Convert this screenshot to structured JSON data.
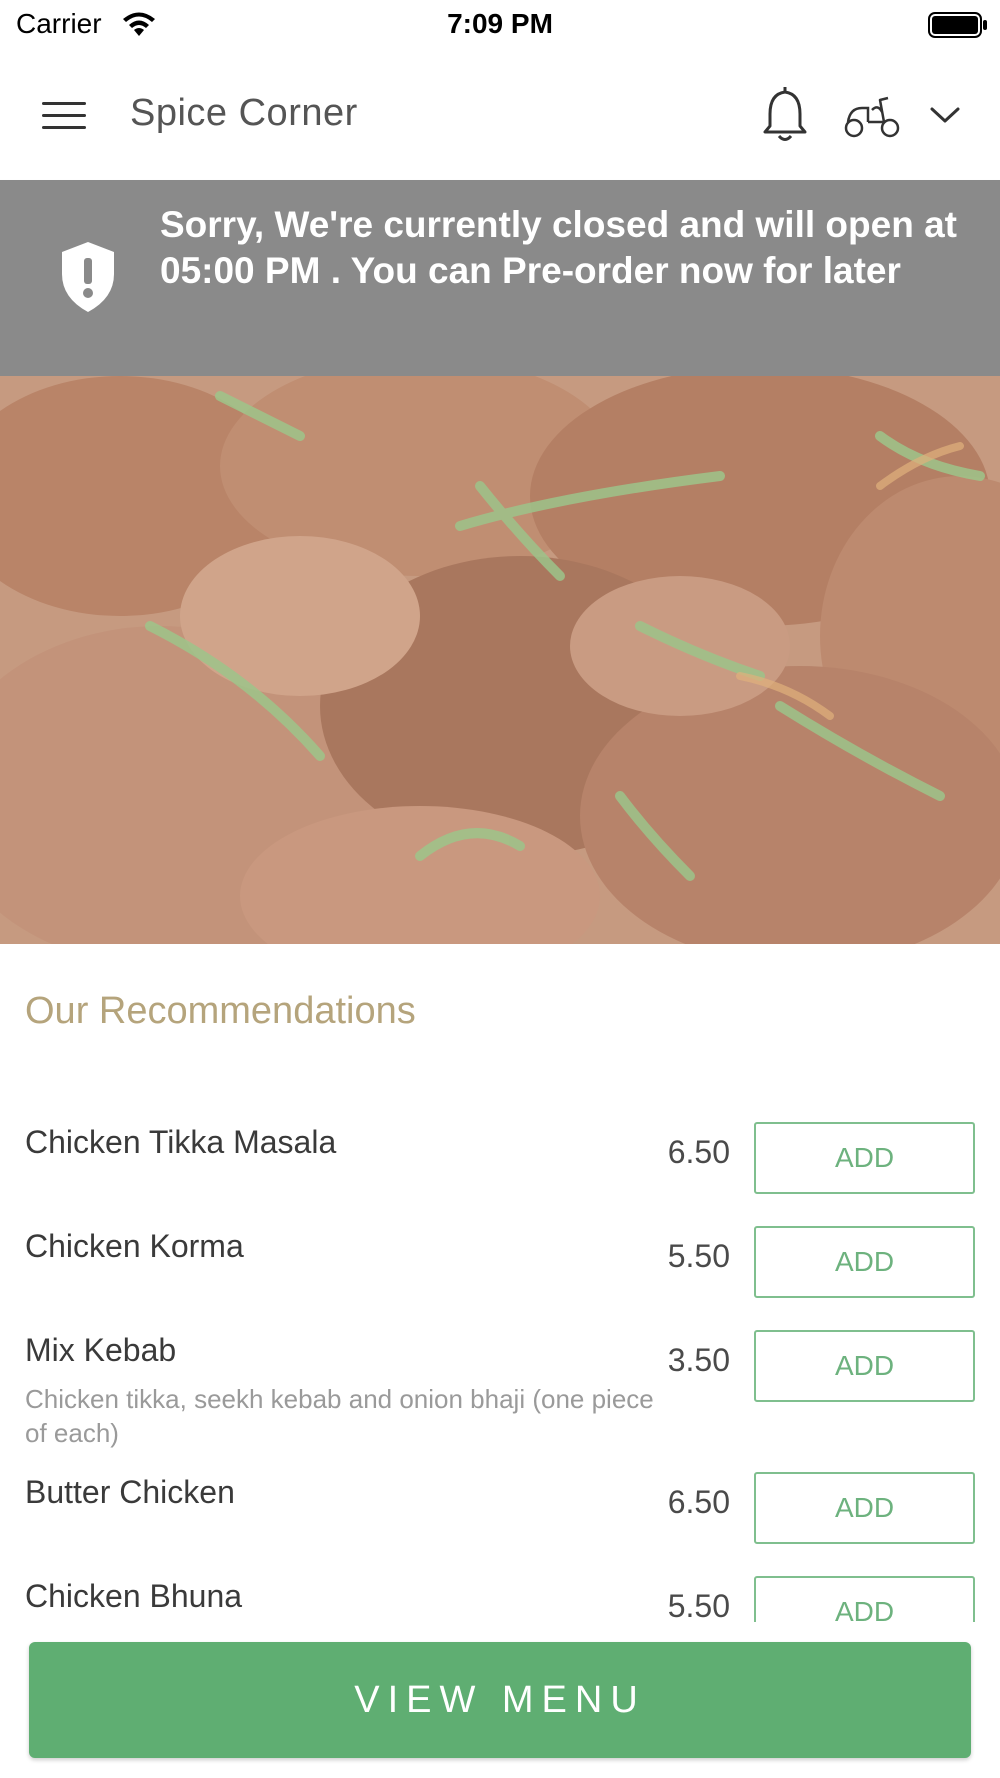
{
  "status_bar": {
    "carrier": "Carrier",
    "time": "7:09 PM"
  },
  "header": {
    "title": "Spice Corner",
    "icons": [
      "menu-icon",
      "bell-icon",
      "scooter-icon",
      "chevron-down-icon"
    ]
  },
  "banner": {
    "message": "Sorry, We're currently closed and will open at 05:00 PM . You can Pre-order now for later",
    "icon": "shield-alert-icon",
    "background": "#8a8a8a"
  },
  "recommendations": {
    "title": "Our Recommendations",
    "items": [
      {
        "name": "Chicken Tikka Masala",
        "description": "",
        "price": "6.50",
        "button": "ADD"
      },
      {
        "name": "Chicken Korma",
        "description": "",
        "price": "5.50",
        "button": "ADD"
      },
      {
        "name": "Mix Kebab",
        "description": "Chicken tikka, seekh kebab and onion bhaji (one piece of each)",
        "price": "3.50",
        "button": "ADD"
      },
      {
        "name": "Butter Chicken",
        "description": "",
        "price": "6.50",
        "button": "ADD"
      },
      {
        "name": "Chicken Bhuna",
        "description": "",
        "price": "5.50",
        "button": "ADD"
      }
    ]
  },
  "footer": {
    "view_menu_label": "VIEW MENU",
    "accent_color": "#5fae72"
  }
}
